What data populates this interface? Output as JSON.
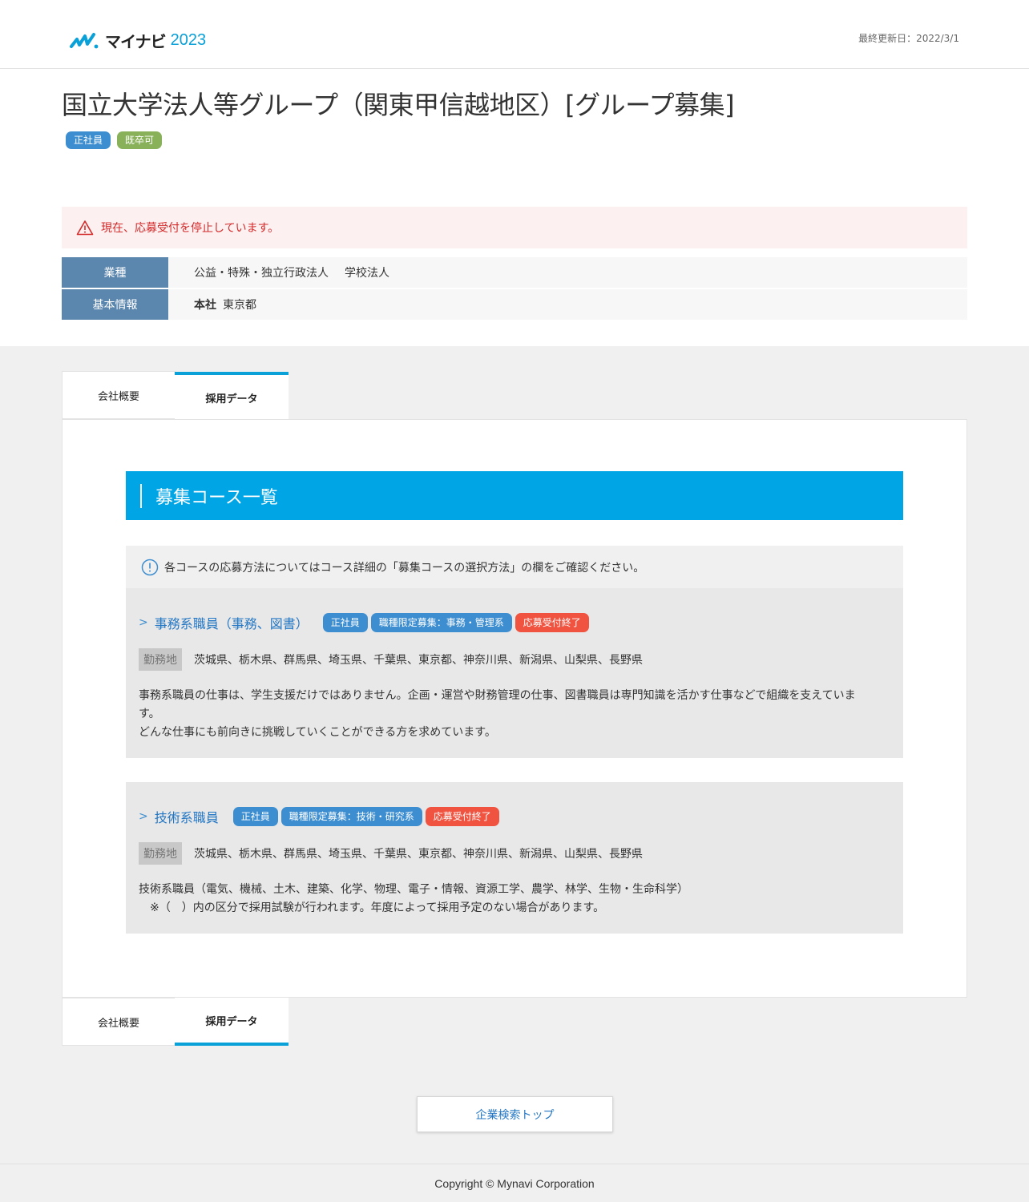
{
  "header": {
    "logo_name": "マイナビ",
    "logo_year": "2023",
    "updated": "最終更新日：2022/3/1"
  },
  "company": {
    "title": "国立大学法人等グループ（関東甲信越地区）[グループ募集]",
    "badges": [
      "正社員",
      "既卒可"
    ]
  },
  "alert": {
    "text": "現在、応募受付を停止しています。"
  },
  "info": {
    "industry_label": "業種",
    "industry_values": [
      "公益・特殊・独立行政法人",
      "学校法人"
    ],
    "basic_label": "基本情報",
    "hq_label": "本社",
    "hq_value": "東京都"
  },
  "tabs": [
    "会社概要",
    "採用データ"
  ],
  "section": {
    "title": "募集コース一覧",
    "note": "各コースの応募方法についてはコース詳細の「募集コースの選択方法」の欄をご確認ください。"
  },
  "courses": [
    {
      "title": "事務系職員（事務、図書）",
      "badges": [
        "正社員",
        "職種限定募集：事務・管理系",
        "応募受付終了"
      ],
      "location_label": "勤務地",
      "location": "茨城県、栃木県、群馬県、埼玉県、千葉県、東京都、神奈川県、新潟県、山梨県、長野県",
      "desc_lines": [
        "事務系職員の仕事は、学生支援だけではありません。企画・運営や財務管理の仕事、図書職員は専門知識を活かす仕事などで組織を支えていま",
        "す。",
        "どんな仕事にも前向きに挑戦していくことができる方を求めています。"
      ]
    },
    {
      "title": "技術系職員",
      "badges": [
        "正社員",
        "職種限定募集：技術・研究系",
        "応募受付終了"
      ],
      "location_label": "勤務地",
      "location": "茨城県、栃木県、群馬県、埼玉県、千葉県、東京都、神奈川県、新潟県、山梨県、長野県",
      "desc_lines": [
        "技術系職員（電気、機械、土木、建築、化学、物理、電子・情報、資源工学、農学、林学、生物・生命科学）",
        "　※（　）内の区分で採用試験が行われます。年度によって採用予定のない場合があります。"
      ]
    }
  ],
  "buttons": {
    "search_top": "企業検索トップ"
  },
  "footer": {
    "copyright": "Copyright © Mynavi Corporation"
  },
  "colors": {
    "accent": "#00a5e6",
    "badge_blue": "#3d8ed0",
    "badge_green": "#89b15a",
    "badge_red": "#f0533f",
    "label_blue": "#5b86ae",
    "alert_text": "#d32a2a"
  }
}
